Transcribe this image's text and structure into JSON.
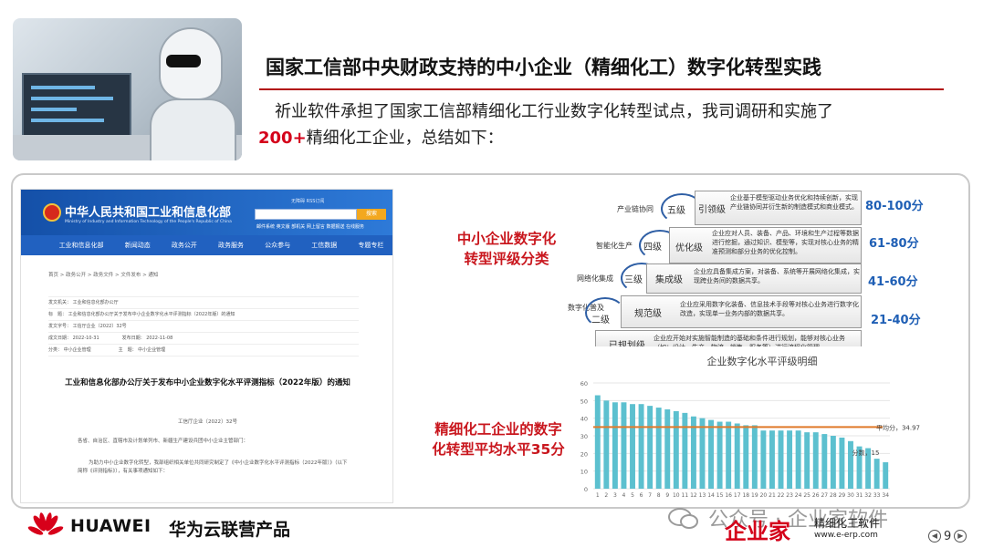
{
  "slide": {
    "title": "国家工信部中央财政支持的中小企业（精细化工）数字化转型实践",
    "intro_text": "祈业软件承担了国家工信部精细化工行业数字化转型试点，我司调研和实施了",
    "intro_highlight": "200+",
    "intro_tail": "精细化工企业，总结如下：",
    "page_number": "9"
  },
  "document": {
    "ministry_name": "中华人民共和国工业和信息化部",
    "ministry_name_en": "Ministry of Industry and Information Technology of the People's Republic of China",
    "search_button": "搜索",
    "top_links": "无障碍  RSS订阅",
    "sub_links": [
      "邮件系统",
      "英文版",
      "部机关",
      "网上留言",
      "数据报送",
      "在线服务"
    ],
    "nav": [
      "工业和信息化部",
      "新闻动态",
      "政务公开",
      "政务服务",
      "公众参与",
      "工信数据",
      "专题专栏"
    ],
    "breadcrumb": "首页 > 政务公开 > 政务文件 > 文件发布 > 通知",
    "meta_rows": [
      "发文机关： 工业和信息化部办公厅",
      "标　题： 工业和信息化部办公厅关于发布中小企业数字化水平评测指标（2022年版）的通知",
      "发文字号： 工信厅企业〔2022〕32号",
      "成文日期： 2022-10-31　　　　　发布日期： 2022-11-08",
      "分类： 中小企业管理　　　　　　主　题： 中小企业管理"
    ],
    "doc_title": "工业和信息化部办公厅关于发布中小企业数字化水平评测指标（2022年版）的通知",
    "doc_number": "工信厅企业〔2022〕32号",
    "para_1": "各省、自治区、直辖市及计划单列市、新疆生产建设兵团中小企业主管部门：",
    "para_2": "为助力中小企业数字化转型，我部组织相关单位共同研究制定了《中小企业数字化水平评测指标（2022年版）》（以下简称《评测指标》），有关事项通知如下："
  },
  "pyramid": {
    "label_line1": "中小企业数字化",
    "label_line2": "转型评级分类",
    "levels": [
      {
        "side": "产业链协同",
        "circle": "五级",
        "name": "引领级",
        "desc": "企业基于模型驱动业务优化和持续创新，实现产业链协同并衍生新的制造模式和商业模式。",
        "score": "80-100分"
      },
      {
        "side": "智能化生产",
        "circle": "四级",
        "name": "优化级",
        "desc": "企业应对人员、装备、产品、环境和生产过程等数据进行挖掘，通过知识、模型等，实现对核心业务的精准预测和部分业务的优化控制。",
        "score": "61-80分"
      },
      {
        "side": "网络化集成",
        "circle": "三级",
        "name": "集成级",
        "desc": "企业应具备集成方案，对装备、系统等开展网络化集成，实现跨业务间的数据共享。",
        "score": "41-60分"
      },
      {
        "side": "数字化普及",
        "circle": "二级",
        "name": "规范级",
        "desc": "企业应采用数字化装备、信息技术手段等对核心业务进行数字化改造，实现单一业务内部的数据共享。",
        "score": "21-40分"
      },
      {
        "side": "",
        "circle": "",
        "name": "已规划级",
        "desc": "企业应开始对实施智能制造的基础和条件进行规划，能够对核心业务（如：设计、生产、物流、销售、服务等）进行流程化管理。",
        "score": ""
      }
    ]
  },
  "avg_section": {
    "label_line1": "精细化工企业的数字",
    "label_line2": "化转型平均水平35分"
  },
  "chart_data": {
    "type": "bar",
    "title": "企业数字化水平评级明细",
    "categories": [
      "1",
      "2",
      "3",
      "4",
      "5",
      "6",
      "7",
      "8",
      "9",
      "10",
      "11",
      "12",
      "13",
      "14",
      "15",
      "16",
      "17",
      "18",
      "19",
      "20",
      "21",
      "22",
      "23",
      "24",
      "25",
      "26",
      "27",
      "28",
      "29",
      "30",
      "31",
      "32",
      "33",
      "34"
    ],
    "values": [
      53,
      50,
      49,
      49,
      48,
      48,
      47,
      46,
      45,
      44,
      43,
      41,
      40,
      39,
      38,
      38,
      37,
      36,
      36,
      33,
      33,
      33,
      33,
      33,
      32,
      32,
      31,
      30,
      29,
      27,
      24,
      23,
      17,
      15
    ],
    "average": 34.97,
    "average_label": "平均分，34.97",
    "last_label": "分数，15",
    "ylim": [
      0,
      60
    ],
    "yticks": [
      "0",
      "10",
      "20",
      "30",
      "40",
      "50",
      "60"
    ],
    "bar_color": "#5cc0cf",
    "avg_color": "#e07a2a",
    "grid": true
  },
  "footer": {
    "brand": "HUAWEI",
    "product": "华为云联营产品",
    "wechat_text": "公众号 · 企业家软件",
    "logo": "企业家",
    "logo_sub": "精细化工软件",
    "logo_url": "www.e-erp.com"
  }
}
